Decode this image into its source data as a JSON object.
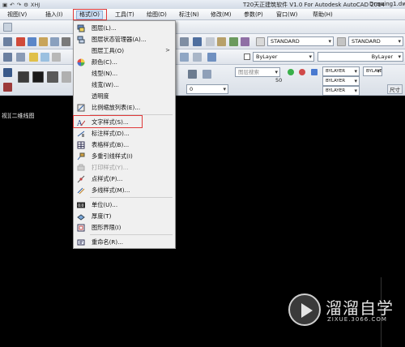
{
  "titlebar": {
    "workspace": "XHJ",
    "app_title": "T20天正建筑软件 V1.0 For Autodesk AutoCAD 2014",
    "drawing": "Drawing1.dw"
  },
  "menubar": {
    "items": [
      {
        "label": "视图(V)"
      },
      {
        "label": "插入(I)"
      },
      {
        "label": "格式(O)"
      },
      {
        "label": "工具(T)"
      },
      {
        "label": "绘图(D)"
      },
      {
        "label": "标注(N)"
      },
      {
        "label": "修改(M)"
      },
      {
        "label": "参数(P)"
      },
      {
        "label": "窗口(W)"
      },
      {
        "label": "帮助(H)"
      }
    ]
  },
  "toolbars": {
    "text_style": "STANDARD",
    "dim_style": "STANDARD",
    "layer": "0",
    "color": "ByLayer",
    "linetype": "ByLayer",
    "lineweight_1": "BYLAYER",
    "lineweight_2": "BYLAYER",
    "lineweight_3": "BYLAYER",
    "lineweight_4": "BYLAYER",
    "layer_search": "图层搜索",
    "zoom_value": "50",
    "size_label": "尺寸"
  },
  "viewport": {
    "label": "视][二维线图"
  },
  "format_menu": {
    "items": [
      {
        "label": "图层(L)...",
        "icon": "layers-icon"
      },
      {
        "label": "图层状态管理器(A)...",
        "icon": "layer-state-icon"
      },
      {
        "label": "图层工具(O)",
        "icon": "",
        "submenu": ">"
      },
      {
        "label": "颜色(C)...",
        "icon": "color-wheel-icon"
      },
      {
        "label": "线型(N)...",
        "icon": ""
      },
      {
        "label": "线宽(W)...",
        "icon": ""
      },
      {
        "label": "透明度",
        "icon": ""
      },
      {
        "label": "比例缩放列表(E)...",
        "icon": "scale-list-icon"
      },
      {
        "label": "文字样式(S)...",
        "icon": "text-style-icon"
      },
      {
        "label": "标注样式(D)...",
        "icon": "dim-style-icon"
      },
      {
        "label": "表格样式(B)...",
        "icon": "table-style-icon"
      },
      {
        "label": "多重引线样式(I)",
        "icon": "mleader-style-icon"
      },
      {
        "label": "打印样式(Y)...",
        "icon": "plot-style-icon"
      },
      {
        "label": "点样式(P)...",
        "icon": "point-style-icon"
      },
      {
        "label": "多线样式(M)...",
        "icon": "mline-style-icon"
      },
      {
        "label": "单位(U)...",
        "icon": "units-icon"
      },
      {
        "label": "厚度(T)",
        "icon": "thickness-icon"
      },
      {
        "label": "图形界限(I)",
        "icon": "limits-icon"
      },
      {
        "label": "重命名(R)...",
        "icon": "rename-icon"
      }
    ]
  },
  "watermark": {
    "brand": "溜溜自学",
    "url": "ZIXUE.3066.COM"
  },
  "colors": {
    "canvas": "#000000",
    "menu_bg": "#f0f0f0",
    "highlight_box": "#e03a3a",
    "menubar_active": "#cfe0f5"
  }
}
